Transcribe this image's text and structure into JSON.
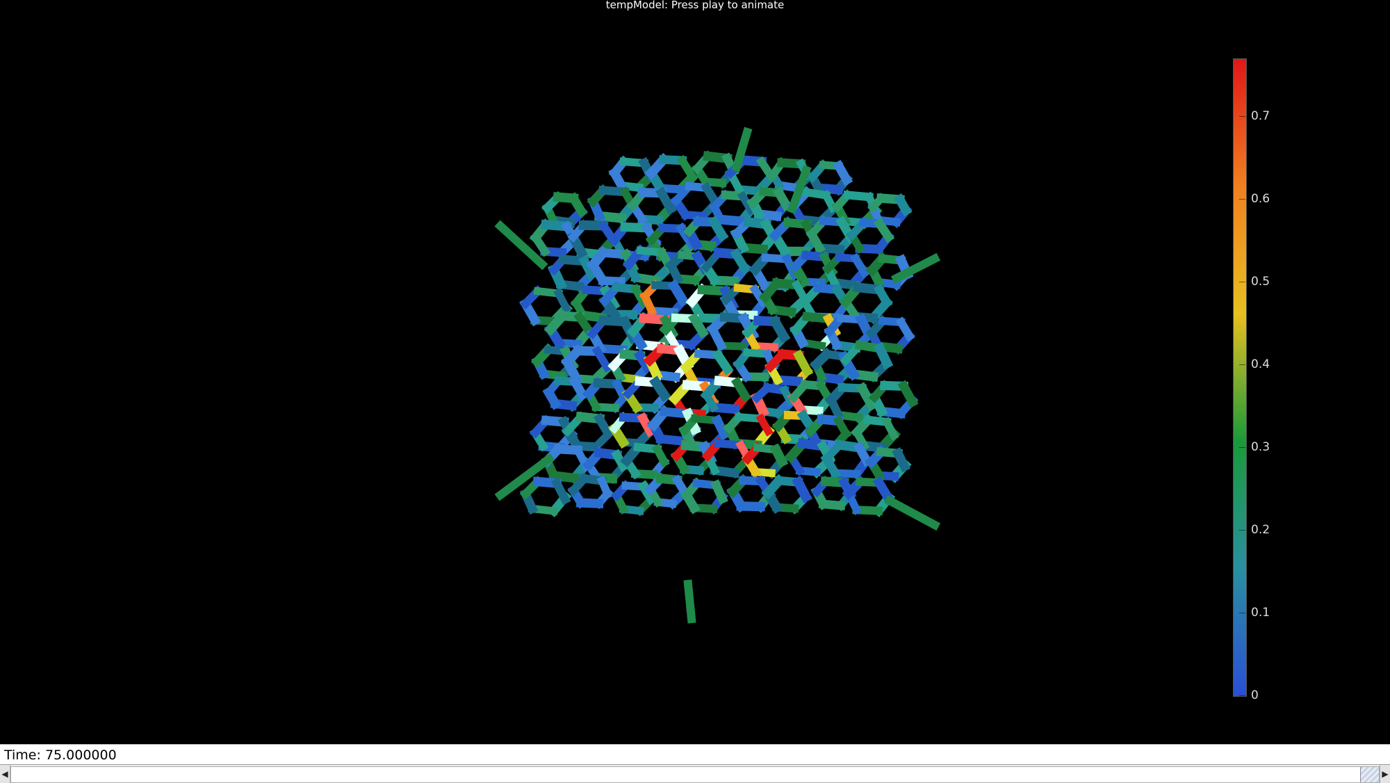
{
  "window": {
    "title": "tempModel: Press play to animate"
  },
  "colorbar": {
    "colors": [
      "#2a4fd6",
      "#2a8fa0",
      "#1a9a3a",
      "#e8c020",
      "#f08020",
      "#e01818"
    ],
    "ticks": [
      {
        "label": "0",
        "value": 0
      },
      {
        "label": "0.1",
        "value": 0.1
      },
      {
        "label": "0.2",
        "value": 0.2
      },
      {
        "label": "0.3",
        "value": 0.3
      },
      {
        "label": "0.4",
        "value": 0.4
      },
      {
        "label": "0.5",
        "value": 0.5
      },
      {
        "label": "0.6",
        "value": 0.6
      },
      {
        "label": "0.7",
        "value": 0.7
      }
    ],
    "min": 0,
    "max": 0.77
  },
  "status": {
    "time": "Time: 75.000000"
  },
  "scrollbar": {
    "left_arrow": "◀",
    "right_arrow": "▶"
  }
}
